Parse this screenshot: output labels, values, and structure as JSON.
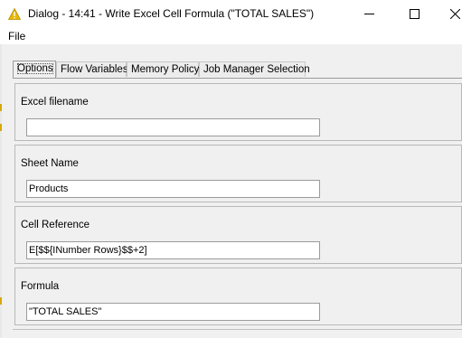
{
  "window": {
    "title": "Dialog - 14:41 - Write Excel Cell Formula (\"TOTAL SALES\")",
    "icon": "warning-triangle-icon",
    "accent": "#e6b800"
  },
  "menu": {
    "file": "File"
  },
  "tabs": [
    {
      "label": "Options",
      "active": true
    },
    {
      "label": "Flow Variables"
    },
    {
      "label": "Memory Policy"
    },
    {
      "label": "Job Manager Selection"
    }
  ],
  "fields": {
    "excel_filename": {
      "label": "Excel filename",
      "value": ""
    },
    "sheet_name": {
      "label": "Sheet Name",
      "value": "Products"
    },
    "cell_reference": {
      "label": "Cell Reference",
      "value": "E[$${INumber Rows}$$+2]"
    },
    "formula": {
      "label": "Formula",
      "value": "\"TOTAL SALES\""
    }
  }
}
